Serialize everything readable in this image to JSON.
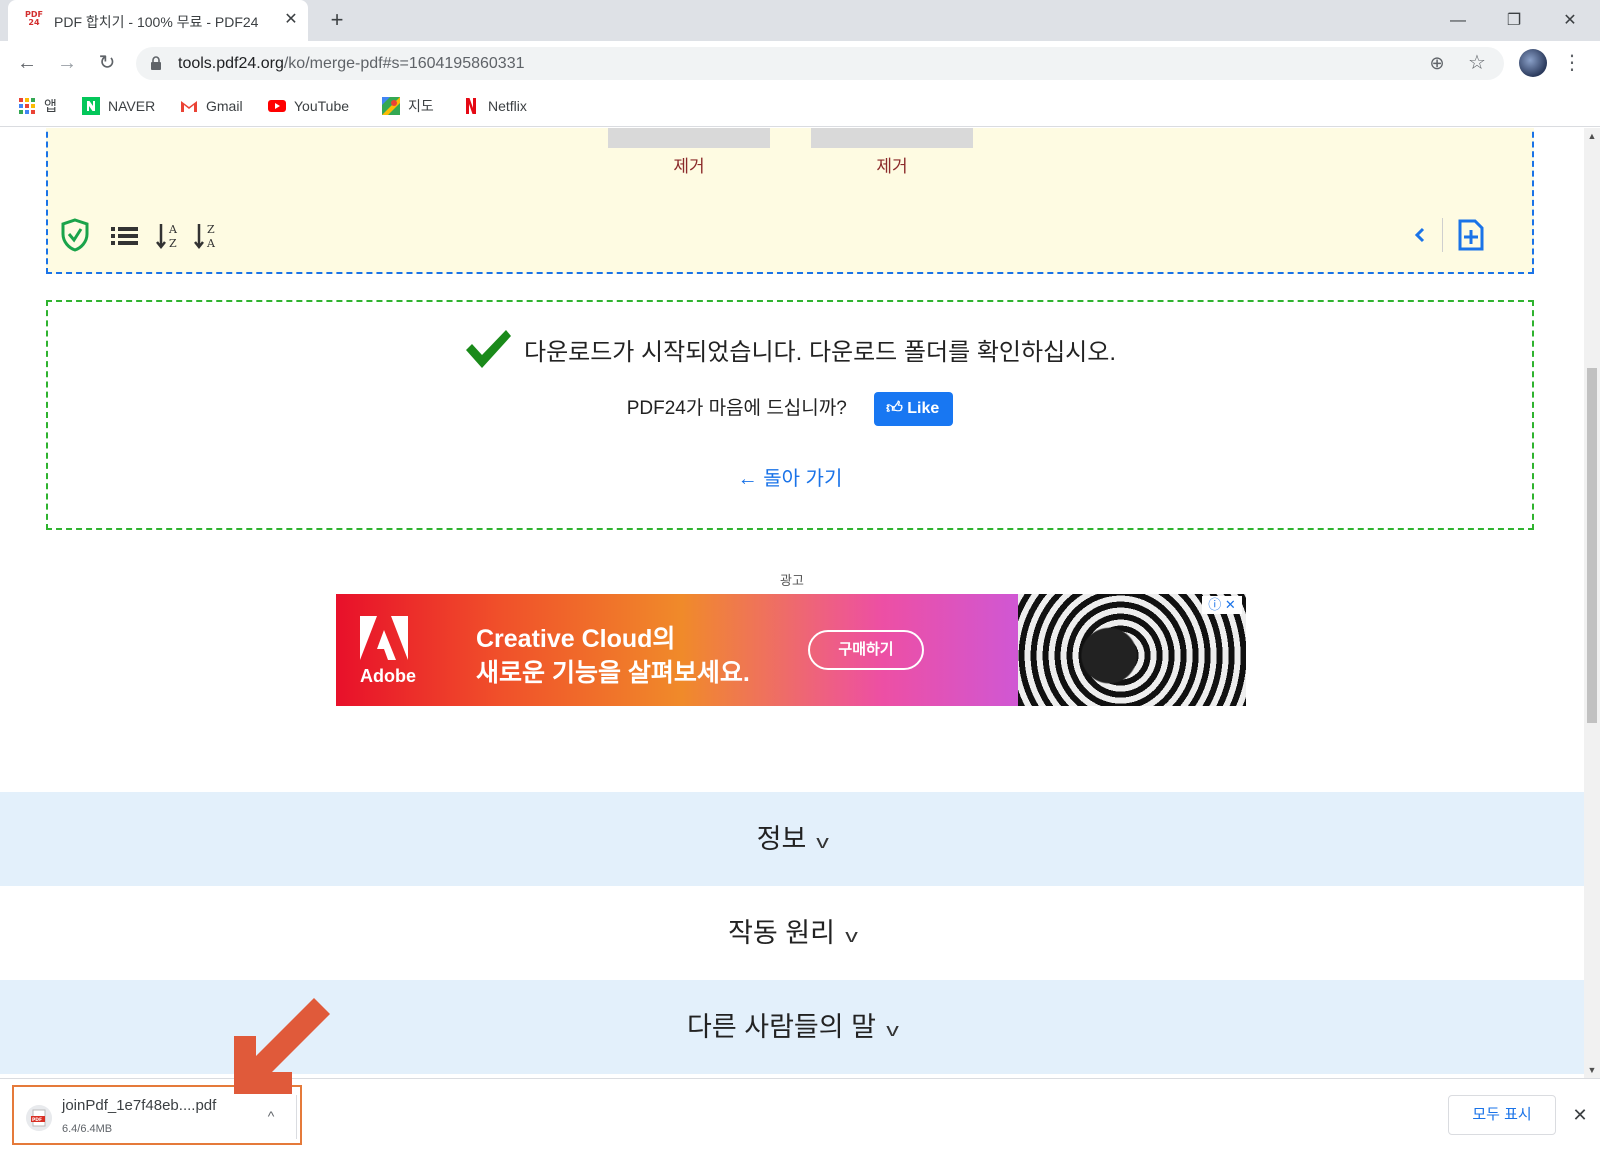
{
  "browser": {
    "tab": {
      "title": "PDF 합치기 - 100% 무료 - PDF24",
      "favicon_text_top": "PDF",
      "favicon_text_bottom": "24"
    },
    "window_controls": {
      "minimize": "—",
      "maximize": "❐",
      "close": "✕"
    },
    "url": {
      "host": "tools.pdf24.org",
      "path": "/ko/merge-pdf#s=1604195860331"
    },
    "bookmarks": [
      {
        "label": "앱",
        "icon": "apps-grid-icon"
      },
      {
        "label": "NAVER",
        "icon": "naver-icon"
      },
      {
        "label": "Gmail",
        "icon": "gmail-icon"
      },
      {
        "label": "YouTube",
        "icon": "youtube-icon"
      },
      {
        "label": "지도",
        "icon": "maps-icon"
      },
      {
        "label": "Netflix",
        "icon": "netflix-icon"
      }
    ]
  },
  "page": {
    "files": [
      {
        "remove_label": "제거"
      },
      {
        "remove_label": "제거"
      }
    ],
    "toolbar_icons": [
      "shield-check-icon",
      "list-icon",
      "sort-az-icon",
      "sort-za-icon",
      "chevron-left-icon",
      "add-file-icon"
    ],
    "download": {
      "message": "다운로드가 시작되었습니다. 다운로드 폴더를 확인하십시오.",
      "like_prompt": "PDF24가 마음에 드십니까?",
      "like_label": "Like",
      "back_label": "돌아 가기",
      "back_arrow": "←"
    },
    "ad": {
      "label": "광고",
      "brand": "Adobe",
      "headline_line1": "Creative Cloud의",
      "headline_line2": "새로운 기능을 살펴보세요.",
      "cta": "구매하기",
      "adchoice": "ⓘ ✕"
    },
    "accordions": [
      {
        "label": "정보"
      },
      {
        "label": "작동 원리"
      },
      {
        "label": "다른 사람들의 말"
      }
    ]
  },
  "download_shelf": {
    "file_name": "joinPdf_1e7f48eb....pdf",
    "size": "6.4/6.4MB",
    "show_all": "모두 표시"
  },
  "colors": {
    "upload_box_bg": "#fefbe2",
    "upload_border": "#1a73e8",
    "done_border": "#2fb32f",
    "accordion_bg": "#e3f0fb",
    "annotation_arrow": "#e05a3a"
  }
}
